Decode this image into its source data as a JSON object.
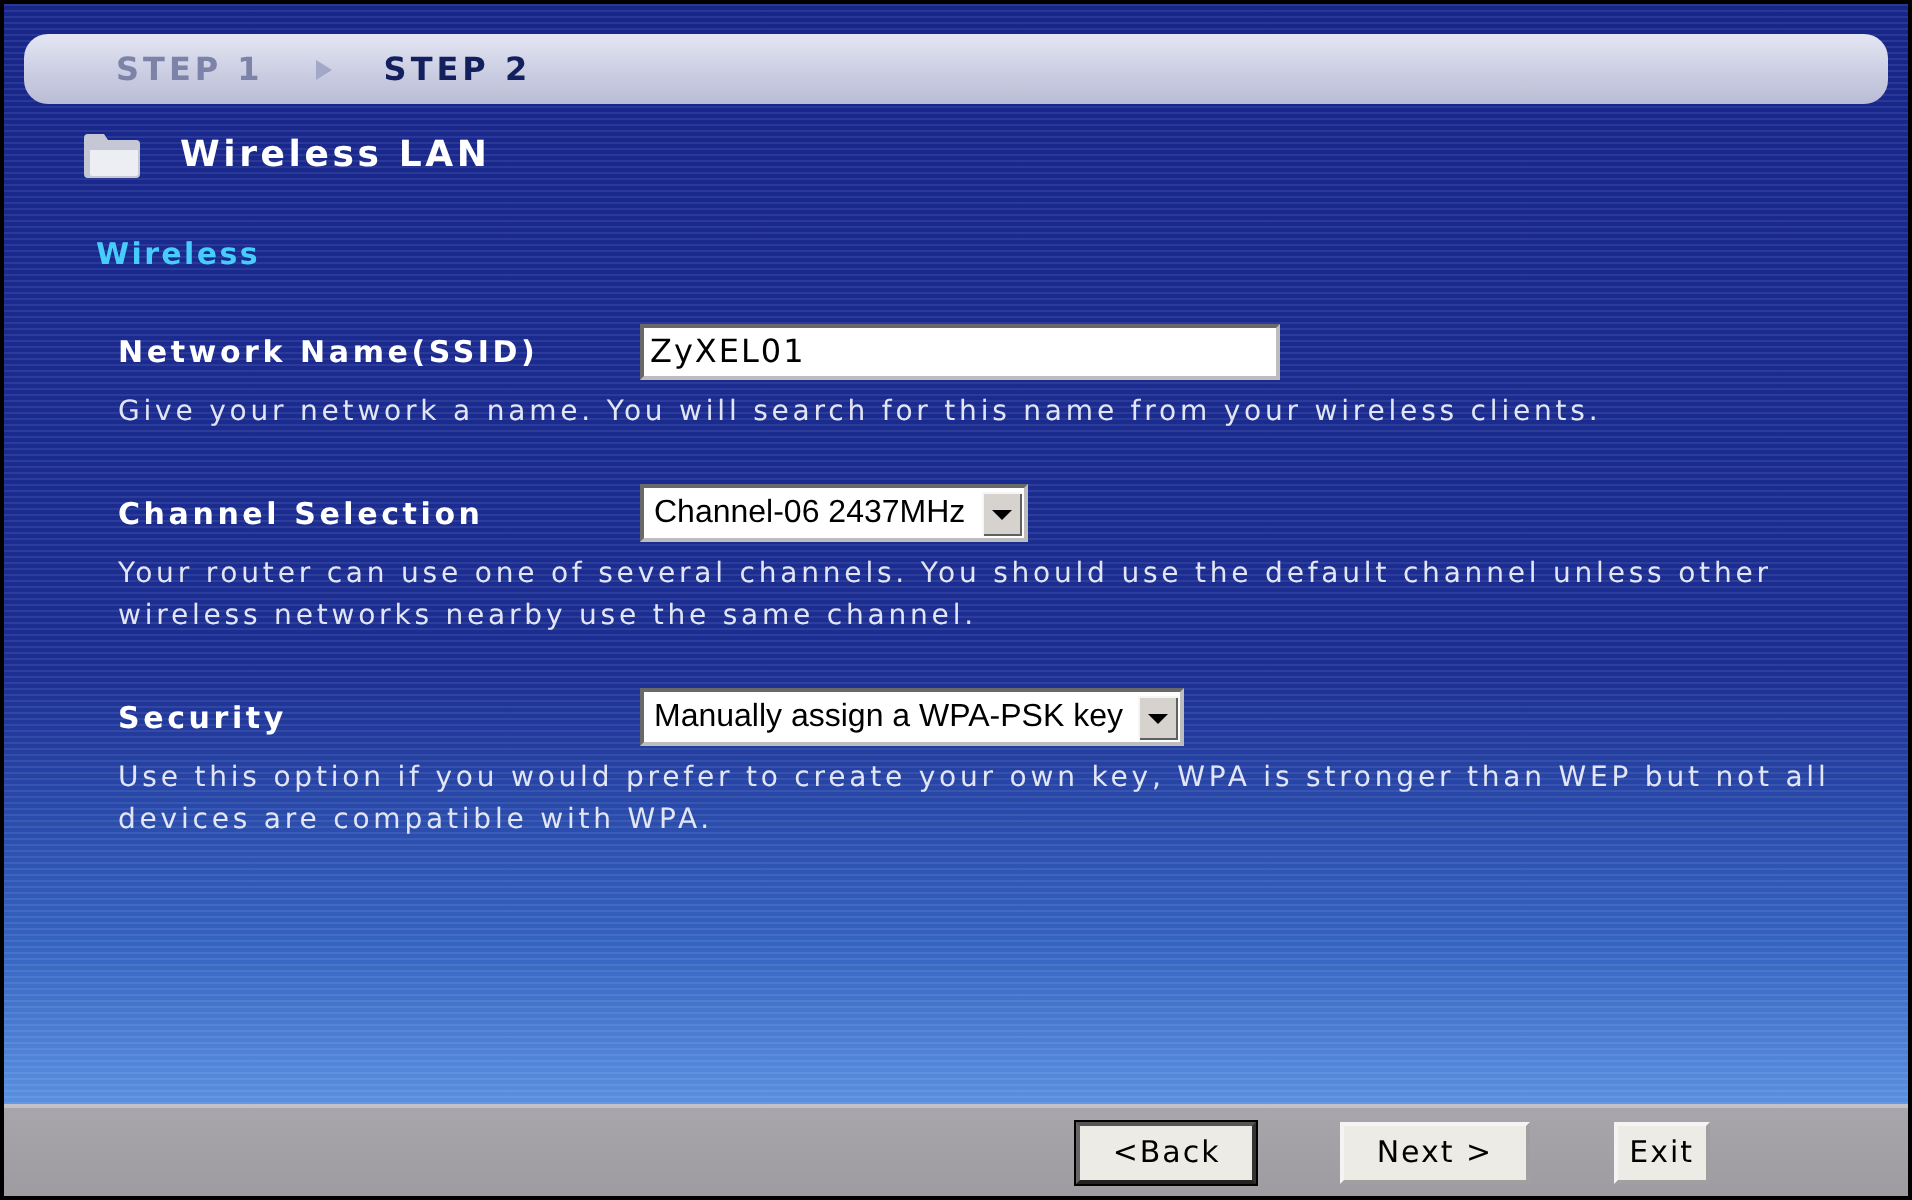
{
  "wizard": {
    "steps": [
      {
        "label": "STEP 1",
        "selected": false
      },
      {
        "label": "STEP 2",
        "selected": true
      }
    ]
  },
  "page": {
    "title": "Wireless LAN",
    "section": "Wireless"
  },
  "fields": [
    {
      "kind": "text",
      "label": "Network Name(SSID)",
      "value": "ZyXEL01",
      "help": "Give your network a name. You will search for this name from your wireless clients."
    },
    {
      "kind": "select",
      "label": "Channel Selection",
      "value": "Channel-06 2437MHz",
      "help": "Your router can use one of several channels. You should use the default channel unless other wireless networks nearby use the same channel."
    },
    {
      "kind": "select",
      "label": "Security",
      "value": "Manually assign a WPA-PSK key",
      "help": "Use this option if you would prefer to create your own key, WPA is stronger than WEP but not all devices are compatible with WPA."
    }
  ],
  "buttons": [
    {
      "label": "<Back",
      "focused": true
    },
    {
      "label": "Next >",
      "focused": false
    },
    {
      "label": "Exit",
      "focused": false
    }
  ]
}
